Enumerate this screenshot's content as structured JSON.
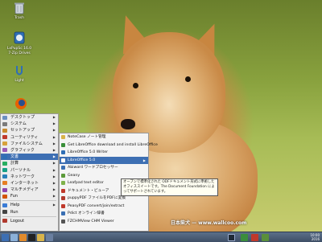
{
  "desktop": {
    "icons": [
      {
        "label": "Trash",
        "icon": "trash-icon"
      },
      {
        "label": "LxPupSc 16.0\n7-Zip Drives",
        "icon": "drive-icon"
      },
      {
        "label": "Light",
        "icon": "light-icon"
      }
    ],
    "watermark": "日本柴犬 — www.wallcoo.com"
  },
  "start_menu": {
    "items": [
      {
        "label": "デスクトップ",
        "color": "#6a8fc1",
        "submenu": true
      },
      {
        "label": "システム",
        "color": "#7b7b7b",
        "submenu": true
      },
      {
        "label": "セットアップ",
        "color": "#c98a2e",
        "submenu": true
      },
      {
        "label": "ユーティリティ",
        "color": "#c0392b",
        "submenu": true
      },
      {
        "label": "ファイルシステム",
        "color": "#d7a23a",
        "submenu": true
      },
      {
        "label": "グラフィック",
        "color": "#9b59b6",
        "submenu": true
      },
      {
        "label": "文書",
        "color": "#2e6fb5",
        "submenu": true
      },
      {
        "label": "計算",
        "color": "#27ae60",
        "submenu": true
      },
      {
        "label": "パーソナル",
        "color": "#16a085",
        "submenu": true
      },
      {
        "label": "ネットワーク",
        "color": "#2980b9",
        "submenu": true
      },
      {
        "label": "インターネット",
        "color": "#e67e22",
        "submenu": true
      },
      {
        "label": "マルチメディア",
        "color": "#8e44ad",
        "submenu": true
      },
      {
        "label": "Fun",
        "color": "#d35400",
        "submenu": true
      }
    ],
    "bottom": [
      {
        "label": "Help",
        "color": "#3a7bd5",
        "submenu": true
      },
      {
        "label": "Run",
        "color": "#444444",
        "submenu": false
      },
      {
        "label": "Logout",
        "color": "#b03a2e",
        "submenu": false
      }
    ],
    "highlighted_index": 6
  },
  "submenu": {
    "items": [
      {
        "label": "NoteCase ノート管理",
        "color": "#d8b34a"
      },
      {
        "label": "Get LibreOffice download and install LibreOffice",
        "color": "#3a8f3a"
      },
      {
        "label": "LibreOffice 5.0 Writer",
        "color": "#2f6fb6"
      },
      {
        "label": "LibreOffice 5.0",
        "color": "#ffffff"
      },
      {
        "label": "Abiword ワードプロセッサー",
        "color": "#3a6fb3"
      },
      {
        "label": "Geany",
        "color": "#5c9a3a"
      },
      {
        "label": "Leafpad text editor",
        "color": "#7fb24a"
      },
      {
        "label": "ドキュメント・ビューア",
        "color": "#c0392b"
      },
      {
        "label": "puppyPDF ファイルをPDFに変換",
        "color": "#b03a2e"
      },
      {
        "label": "PeasyPDF convert/join/extract",
        "color": "#c0392b"
      },
      {
        "label": "Pdict オンライン辞書",
        "color": "#3a6fb3"
      },
      {
        "label": "FZCHMView CHM Viewer",
        "color": "#555555"
      }
    ],
    "highlighted_index": 3
  },
  "tooltip": {
    "line1": "オープンで標準化された ODFドキュメント形式に準拠した",
    "line2": "オフィススイートです。The Document Foundation によ",
    "line3": "ってサポートされています。"
  },
  "taskbar": {
    "left_icons": [
      "puppy-menu-icon",
      "home-icon",
      "browser-icon",
      "terminal-icon",
      "file-manager-icon",
      "desktop-icon"
    ],
    "tray_icons": [
      "network-icon",
      "volume-icon",
      "update-icon",
      "battery-icon"
    ],
    "time": "10:00",
    "date": "2016"
  }
}
